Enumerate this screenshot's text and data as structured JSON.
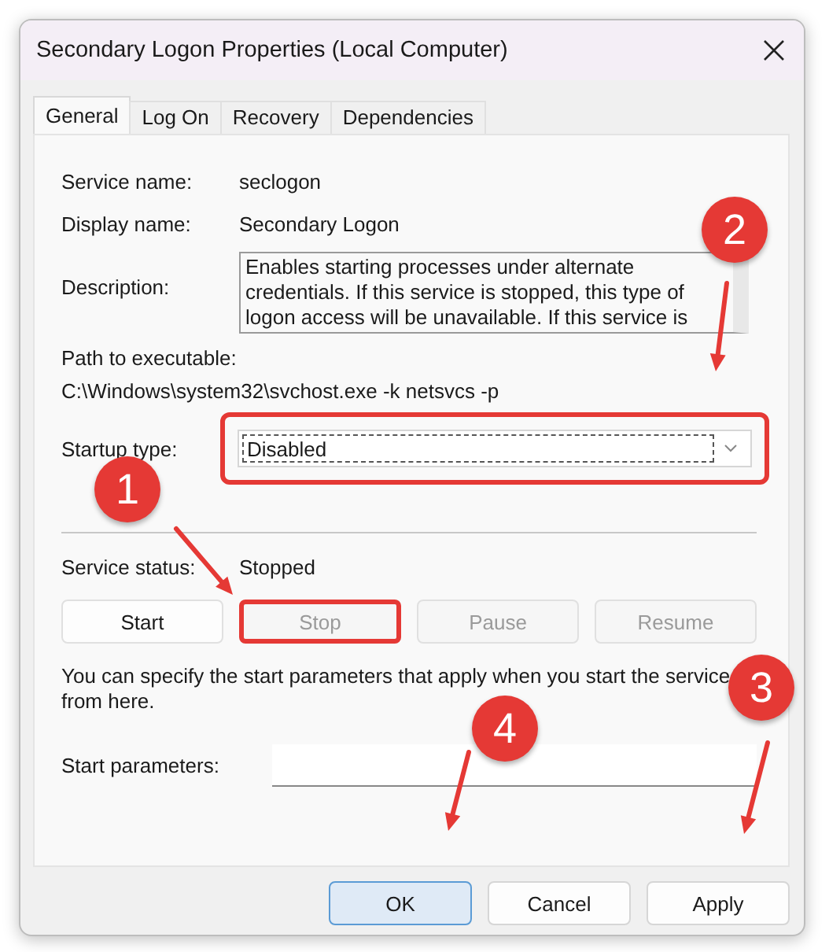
{
  "window": {
    "title": "Secondary Logon Properties (Local Computer)"
  },
  "tabs": [
    {
      "label": "General",
      "selected": true
    },
    {
      "label": "Log On",
      "selected": false
    },
    {
      "label": "Recovery",
      "selected": false
    },
    {
      "label": "Dependencies",
      "selected": false
    }
  ],
  "service_name": {
    "label": "Service name:",
    "value": "seclogon"
  },
  "display_name": {
    "label": "Display name:",
    "value": "Secondary Logon"
  },
  "description": {
    "label": "Description:",
    "value": "Enables starting processes under alternate credentials. If this service is stopped, this type of logon access will be unavailable. If this service is"
  },
  "path": {
    "label": "Path to executable:",
    "value": "C:\\Windows\\system32\\svchost.exe -k netsvcs -p"
  },
  "startup_type": {
    "label": "Startup type:",
    "value": "Disabled",
    "highlighted": true
  },
  "service_status": {
    "label": "Service status:",
    "value": "Stopped"
  },
  "service_buttons": [
    {
      "label": "Start",
      "disabled": false,
      "highlighted": false
    },
    {
      "label": "Stop",
      "disabled": true,
      "highlighted": true
    },
    {
      "label": "Pause",
      "disabled": true,
      "highlighted": false
    },
    {
      "label": "Resume",
      "disabled": true,
      "highlighted": false
    }
  ],
  "note": "You can specify the start parameters that apply when you start the service from here.",
  "start_parameters": {
    "label": "Start parameters:"
  },
  "dialog_buttons": [
    {
      "label": "OK",
      "default": true
    },
    {
      "label": "Cancel",
      "default": false
    },
    {
      "label": "Apply",
      "default": false
    }
  ],
  "markers": [
    {
      "label": "1"
    },
    {
      "label": "2"
    },
    {
      "label": "3"
    },
    {
      "label": "4"
    }
  ]
}
